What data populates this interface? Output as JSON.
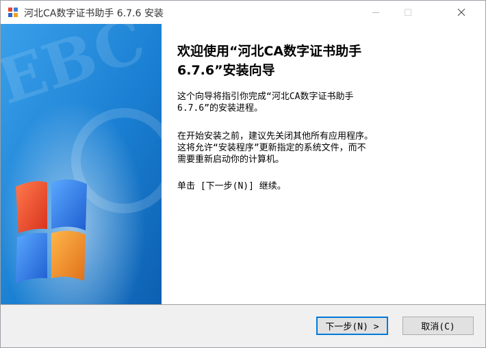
{
  "window": {
    "title": "河北CA数字证书助手 6.7.6 安装"
  },
  "welcome": {
    "heading": "欢迎使用“河北CA数字证书助手\n6.7.6”安装向导",
    "intro": "这个向导将指引你完成“河北CA数字证书助手\n6.7.6”的安装进程。",
    "advice": "在开始安装之前，建议先关闭其他所有应用程序。\n这将允许“安装程序”更新指定的系统文件，而不\n需要重新启动你的计算机。",
    "instruction": "单击 [下一步(N)] 继续。"
  },
  "buttons": {
    "next_label": "下一步(N) >",
    "cancel_label": "取消(C)"
  },
  "icons": {
    "app": "installer-app-icon",
    "minimize": "minimize-icon",
    "maximize": "maximize-icon",
    "close": "close-icon",
    "banner_logo": "windows-flag-logo"
  },
  "colors": {
    "banner": "#1f86d8",
    "footer": "#f0f0f0",
    "focus": "#0078d7"
  }
}
